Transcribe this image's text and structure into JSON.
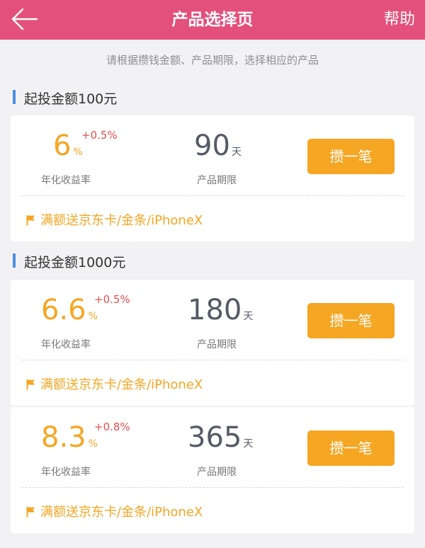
{
  "header": {
    "title": "产品选择页",
    "help_label": "帮助"
  },
  "tip": "请根据攒钱金额、产品期限，选择相应的产品",
  "colors": {
    "nav_bg": "#e4507c",
    "accent": "#f5a623",
    "bonus": "#e45050",
    "section_bar": "#4a90e2"
  },
  "sections": [
    {
      "title": "起投金额100元",
      "products": [
        {
          "rate": "6",
          "rate_unit": "%",
          "bonus": "+0.5%",
          "rate_label": "年化收益率",
          "days": "90",
          "days_unit": "天",
          "days_label": "产品期限",
          "button": "攒一笔",
          "promo": "满额送京东卡/金条/iPhoneX"
        }
      ]
    },
    {
      "title": "起投金额1000元",
      "products": [
        {
          "rate": "6.6",
          "rate_unit": "%",
          "bonus": "+0.5%",
          "rate_label": "年化收益率",
          "days": "180",
          "days_unit": "天",
          "days_label": "产品期限",
          "button": "攒一笔",
          "promo": "满额送京东卡/金条/iPhoneX"
        },
        {
          "rate": "8.3",
          "rate_unit": "%",
          "bonus": "+0.8%",
          "rate_label": "年化收益率",
          "days": "365",
          "days_unit": "天",
          "days_label": "产品期限",
          "button": "攒一笔",
          "promo": "满额送京东卡/金条/iPhoneX"
        }
      ]
    }
  ]
}
